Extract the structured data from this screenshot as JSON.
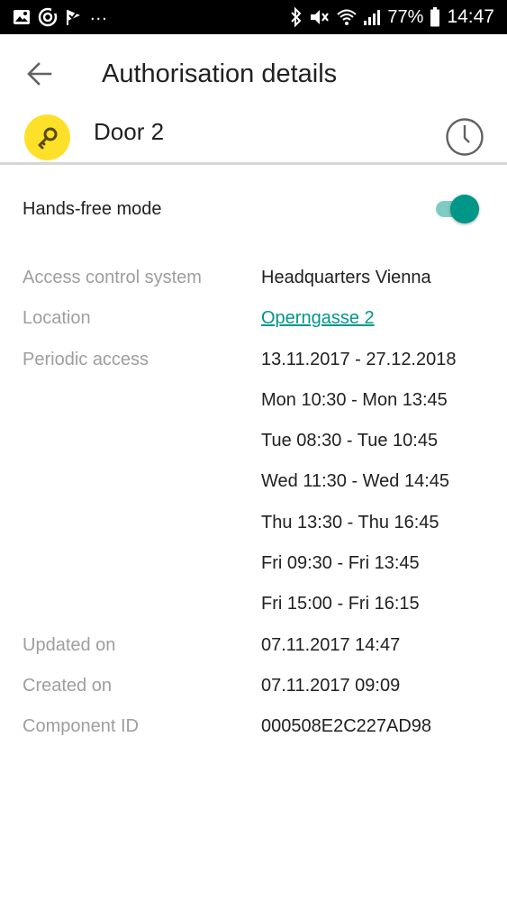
{
  "status_bar": {
    "left_icons": [
      "image-icon",
      "target-icon",
      "check-flag-icon"
    ],
    "overflow": "...",
    "right_icons": [
      "bluetooth-icon",
      "mute-icon",
      "wifi-icon",
      "signal-icon",
      "battery-icon"
    ],
    "battery": "77%",
    "time": "14:47"
  },
  "header": {
    "back_icon": "arrow-back-icon",
    "title": "Authorisation details"
  },
  "door": {
    "icon": "key-icon",
    "name": "Door 2",
    "history_icon": "clock-icon",
    "badge_color": "#fde02a"
  },
  "hands_free": {
    "label": "Hands-free mode",
    "enabled": true,
    "accent_color": "#009688"
  },
  "details": {
    "access_control_system": {
      "label": "Access control system",
      "value": "Headquarters Vienna"
    },
    "location": {
      "label": "Location",
      "value": "Operngasse 2"
    },
    "periodic_access": {
      "label": "Periodic access",
      "values": [
        "13.11.2017 - 27.12.2018",
        "Mon 10:30 - Mon 13:45",
        "Tue 08:30 - Tue 10:45",
        "Wed 11:30 - Wed 14:45",
        "Thu 13:30 - Thu 16:45",
        "Fri 09:30 - Fri 13:45",
        "Fri 15:00 - Fri 16:15"
      ]
    },
    "updated_on": {
      "label": "Updated on",
      "value": "07.11.2017 14:47"
    },
    "created_on": {
      "label": "Created on",
      "value": "07.11.2017 09:09"
    },
    "component_id": {
      "label": "Component ID",
      "value": "000508E2C227AD98"
    }
  }
}
